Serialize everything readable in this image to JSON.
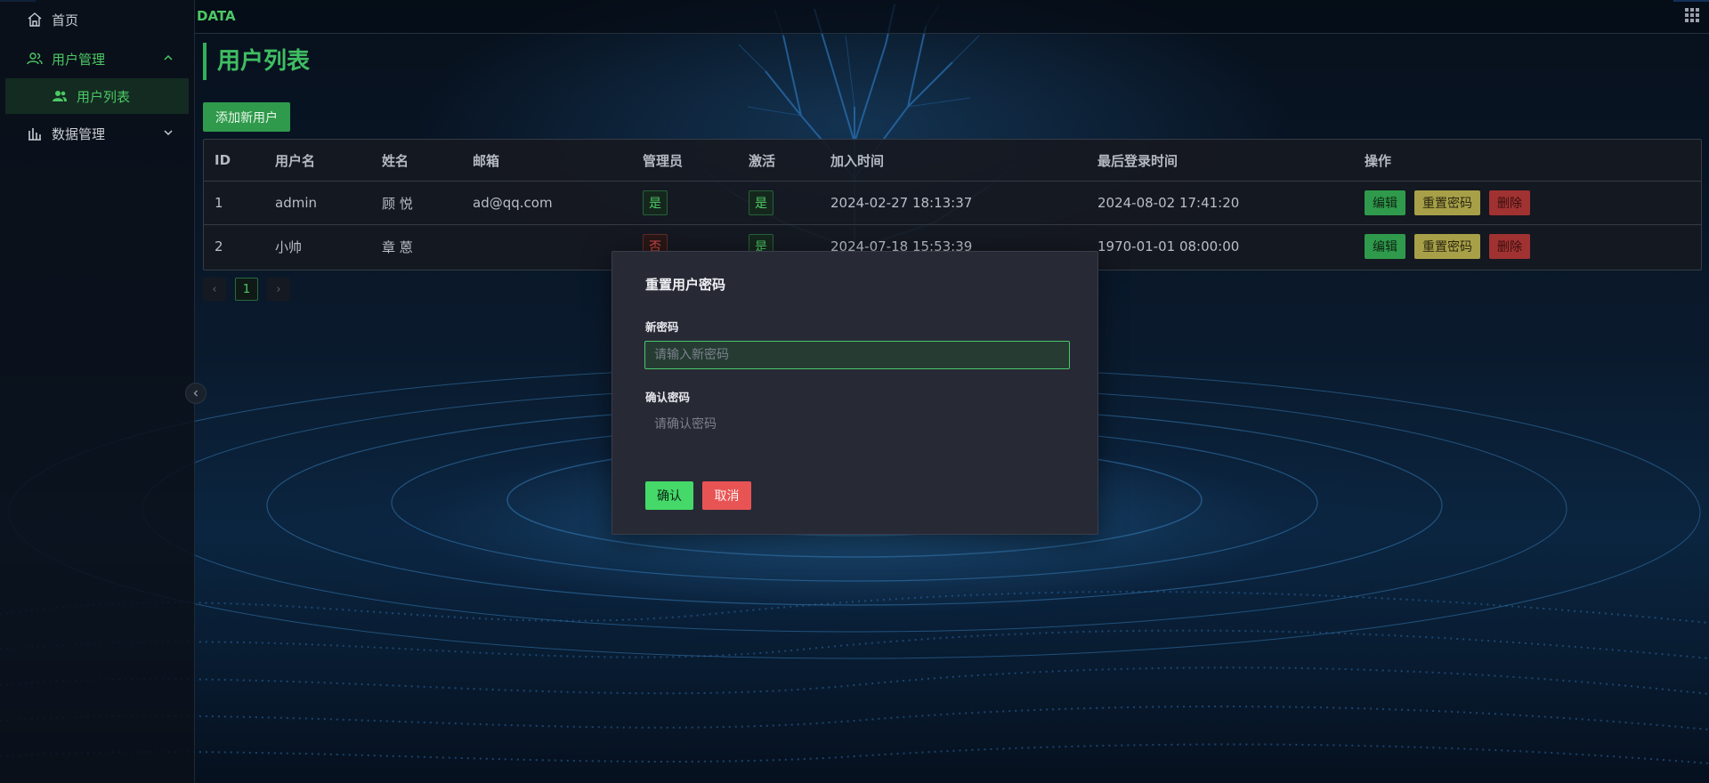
{
  "colors": {
    "accent": "#4cc864",
    "edit": "#2f9a4b",
    "reset": "#a8a048",
    "delete": "#a03232",
    "confirm": "#44d968",
    "cancel": "#e85454"
  },
  "sidebar": {
    "items": [
      {
        "label": "首页",
        "icon": "home-icon"
      },
      {
        "label": "用户管理",
        "icon": "users-icon",
        "expanded": true
      },
      {
        "label": "数据管理",
        "icon": "bar-chart-icon",
        "expanded": false
      }
    ],
    "sub_items": [
      {
        "label": "用户列表",
        "icon": "user-group-icon",
        "active": true
      }
    ]
  },
  "header": {
    "brand": "DATA"
  },
  "page": {
    "title": "用户列表",
    "add_button": "添加新用户"
  },
  "table": {
    "columns": [
      "ID",
      "用户名",
      "姓名",
      "邮箱",
      "管理员",
      "激活",
      "加入时间",
      "最后登录时间",
      "操作"
    ],
    "rows": [
      {
        "id": "1",
        "username": "admin",
        "name": "顾 悦",
        "email": "ad@qq.com",
        "admin": "是",
        "admin_flag": true,
        "active": "是",
        "active_flag": true,
        "joined": "2024-02-27 18:13:37",
        "last_login": "2024-08-02 17:41:20"
      },
      {
        "id": "2",
        "username": "小帅",
        "name": "章 蒽",
        "email": "",
        "admin": "否",
        "admin_flag": false,
        "active": "是",
        "active_flag": true,
        "joined": "2024-07-18 15:53:39",
        "last_login": "1970-01-01 08:00:00"
      }
    ],
    "actions": {
      "edit": "编辑",
      "reset_password": "重置密码",
      "delete": "删除"
    }
  },
  "pagination": {
    "prev": "‹",
    "current": "1",
    "next": "›"
  },
  "modal": {
    "title": "重置用户密码",
    "new_password_label": "新密码",
    "new_password_placeholder": "请输入新密码",
    "confirm_password_label": "确认密码",
    "confirm_password_placeholder": "请确认密码",
    "confirm_button": "确认",
    "cancel_button": "取消"
  }
}
